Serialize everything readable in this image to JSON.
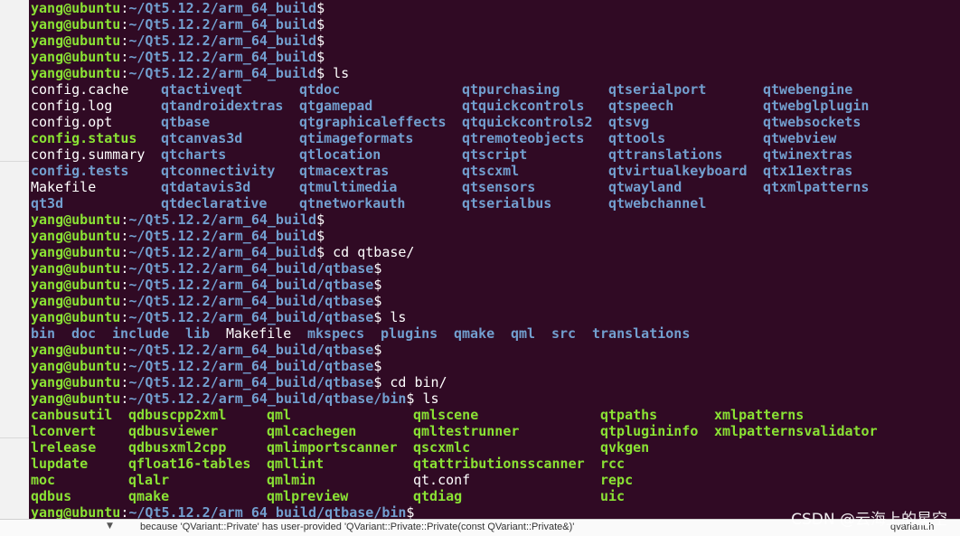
{
  "prompt_user": "yang@ubuntu",
  "prompt_sep": ":",
  "prompt_dollar": "$",
  "paths": {
    "build": "~/Qt5.12.2/arm_64_build",
    "qtbase": "~/Qt5.12.2/arm_64_build/qtbase",
    "bin": "~/Qt5.12.2/arm_64_build/qtbase/bin"
  },
  "commands": {
    "ls": " ls",
    "cd_qtbase": " cd qtbase/",
    "cd_bin": " cd bin/"
  },
  "ls_build": [
    {
      "t": "config.cache",
      "k": "file"
    },
    {
      "t": "qtactiveqt",
      "k": "dir"
    },
    {
      "t": "qtdoc",
      "k": "dir"
    },
    {
      "t": "qtpurchasing",
      "k": "dir"
    },
    {
      "t": "qtserialport",
      "k": "dir"
    },
    {
      "t": "qtwebengine",
      "k": "dir"
    },
    {
      "t": "config.log",
      "k": "file"
    },
    {
      "t": "qtandroidextras",
      "k": "dir"
    },
    {
      "t": "qtgamepad",
      "k": "dir"
    },
    {
      "t": "qtquickcontrols",
      "k": "dir"
    },
    {
      "t": "qtspeech",
      "k": "dir"
    },
    {
      "t": "qtwebglplugin",
      "k": "dir"
    },
    {
      "t": "config.opt",
      "k": "file"
    },
    {
      "t": "qtbase",
      "k": "dir"
    },
    {
      "t": "qtgraphicaleffects",
      "k": "dir"
    },
    {
      "t": "qtquickcontrols2",
      "k": "dir"
    },
    {
      "t": "qtsvg",
      "k": "dir"
    },
    {
      "t": "qtwebsockets",
      "k": "dir"
    },
    {
      "t": "config.status",
      "k": "exe"
    },
    {
      "t": "qtcanvas3d",
      "k": "dir"
    },
    {
      "t": "qtimageformats",
      "k": "dir"
    },
    {
      "t": "qtremoteobjects",
      "k": "dir"
    },
    {
      "t": "qttools",
      "k": "dir"
    },
    {
      "t": "qtwebview",
      "k": "dir"
    },
    {
      "t": "config.summary",
      "k": "file"
    },
    {
      "t": "qtcharts",
      "k": "dir"
    },
    {
      "t": "qtlocation",
      "k": "dir"
    },
    {
      "t": "qtscript",
      "k": "dir"
    },
    {
      "t": "qttranslations",
      "k": "dir"
    },
    {
      "t": "qtwinextras",
      "k": "dir"
    },
    {
      "t": "config.tests",
      "k": "dir"
    },
    {
      "t": "qtconnectivity",
      "k": "dir"
    },
    {
      "t": "qtmacextras",
      "k": "dir"
    },
    {
      "t": "qtscxml",
      "k": "dir"
    },
    {
      "t": "qtvirtualkeyboard",
      "k": "dir"
    },
    {
      "t": "qtx11extras",
      "k": "dir"
    },
    {
      "t": "Makefile",
      "k": "file"
    },
    {
      "t": "qtdatavis3d",
      "k": "dir"
    },
    {
      "t": "qtmultimedia",
      "k": "dir"
    },
    {
      "t": "qtsensors",
      "k": "dir"
    },
    {
      "t": "qtwayland",
      "k": "dir"
    },
    {
      "t": "qtxmlpatterns",
      "k": "dir"
    },
    {
      "t": "qt3d",
      "k": "dir"
    },
    {
      "t": "qtdeclarative",
      "k": "dir"
    },
    {
      "t": "qtnetworkauth",
      "k": "dir"
    },
    {
      "t": "qtserialbus",
      "k": "dir"
    },
    {
      "t": "qtwebchannel",
      "k": "dir"
    }
  ],
  "ls_qtbase": [
    {
      "t": "bin",
      "k": "dir"
    },
    {
      "t": "doc",
      "k": "dir"
    },
    {
      "t": "include",
      "k": "dir"
    },
    {
      "t": "lib",
      "k": "dir"
    },
    {
      "t": "Makefile",
      "k": "file"
    },
    {
      "t": "mkspecs",
      "k": "dir"
    },
    {
      "t": "plugins",
      "k": "dir"
    },
    {
      "t": "qmake",
      "k": "dir"
    },
    {
      "t": "qml",
      "k": "dir"
    },
    {
      "t": "src",
      "k": "dir"
    },
    {
      "t": "translations",
      "k": "dir"
    }
  ],
  "ls_bin": [
    {
      "t": "canbusutil",
      "k": "exe"
    },
    {
      "t": "qdbuscpp2xml",
      "k": "exe"
    },
    {
      "t": "qml",
      "k": "exe"
    },
    {
      "t": "qmlscene",
      "k": "exe"
    },
    {
      "t": "qtpaths",
      "k": "exe"
    },
    {
      "t": "xmlpatterns",
      "k": "exe"
    },
    {
      "t": "lconvert",
      "k": "exe"
    },
    {
      "t": "qdbusviewer",
      "k": "exe"
    },
    {
      "t": "qmlcachegen",
      "k": "exe"
    },
    {
      "t": "qmltestrunner",
      "k": "exe"
    },
    {
      "t": "qtplugininfo",
      "k": "exe"
    },
    {
      "t": "xmlpatternsvalidator",
      "k": "exe"
    },
    {
      "t": "lrelease",
      "k": "exe"
    },
    {
      "t": "qdbusxml2cpp",
      "k": "exe"
    },
    {
      "t": "qmlimportscanner",
      "k": "exe"
    },
    {
      "t": "qscxmlc",
      "k": "exe"
    },
    {
      "t": "qvkgen",
      "k": "exe"
    },
    {
      "t": "lupdate",
      "k": "exe"
    },
    {
      "t": "qfloat16-tables",
      "k": "exe"
    },
    {
      "t": "qmllint",
      "k": "exe"
    },
    {
      "t": "qtattributionsscanner",
      "k": "exe"
    },
    {
      "t": "rcc",
      "k": "exe"
    },
    {
      "t": "moc",
      "k": "exe"
    },
    {
      "t": "qlalr",
      "k": "exe"
    },
    {
      "t": "qmlmin",
      "k": "exe"
    },
    {
      "t": "qt.conf",
      "k": "file"
    },
    {
      "t": "repc",
      "k": "exe"
    },
    {
      "t": "qdbus",
      "k": "exe"
    },
    {
      "t": "qmake",
      "k": "exe"
    },
    {
      "t": "qmlpreview",
      "k": "exe"
    },
    {
      "t": "qtdiag",
      "k": "exe"
    },
    {
      "t": "uic",
      "k": "exe"
    }
  ],
  "background": {
    "bottom_text": "because 'QVariant::Private' has user-provided 'QVariant::Private::Private(const QVariant::Private&)'",
    "bottom_file": "qvariant.h"
  },
  "watermark": "CSDN @云海上的星空",
  "colors": {
    "terminal_bg": "#300a24",
    "prompt_user": "#8ae234",
    "prompt_path": "#729fcf",
    "text": "#ffffff"
  }
}
